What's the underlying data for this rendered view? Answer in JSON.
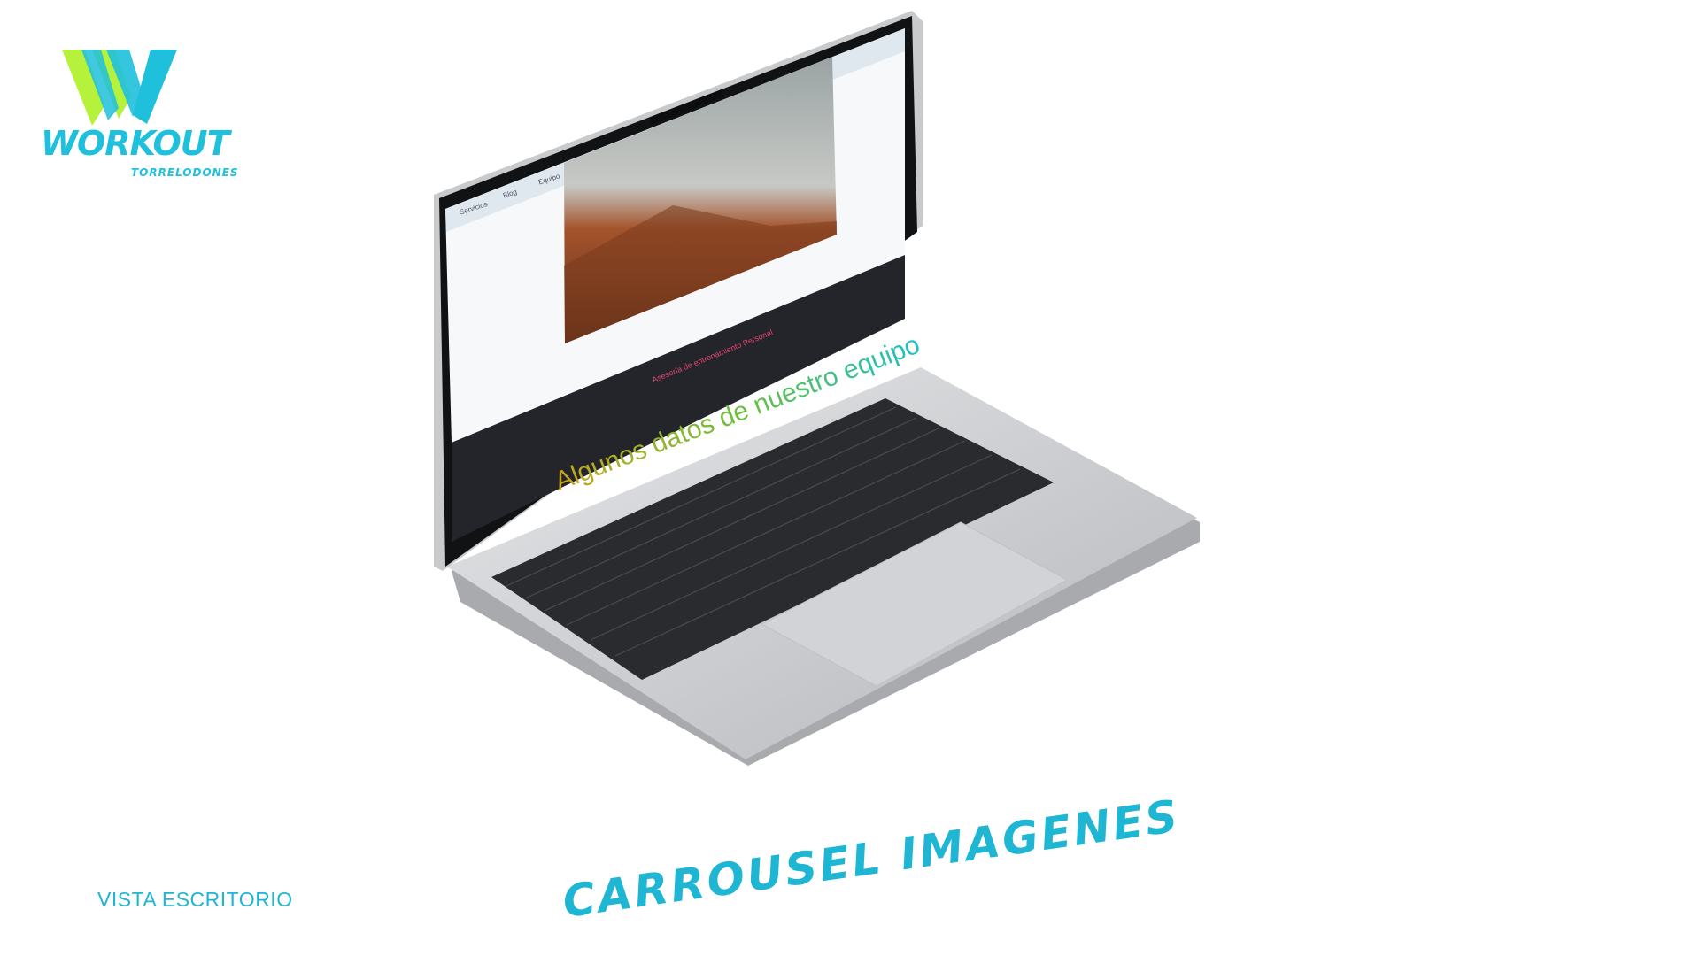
{
  "logo": {
    "word": "WORKOUT",
    "sub": "TORRELODONES",
    "colors": {
      "cyan": "#1fc0dc",
      "lime": "#b6f23c"
    }
  },
  "screen": {
    "nav": [
      "Servicios",
      "Blog",
      "Equipo"
    ],
    "kicker": "Asesoría de entrenamiento Personal",
    "headline": "Algunos datos de nuestro equipo",
    "colors": {
      "dark_band": "#23252b",
      "nav_bar": "#dfe8ee",
      "kicker": "#e0446b"
    }
  },
  "captions": {
    "view": "VISTA ESCRITORIO",
    "title": "CARROUSEL IMAGENES",
    "color": "#1fb6d3"
  }
}
